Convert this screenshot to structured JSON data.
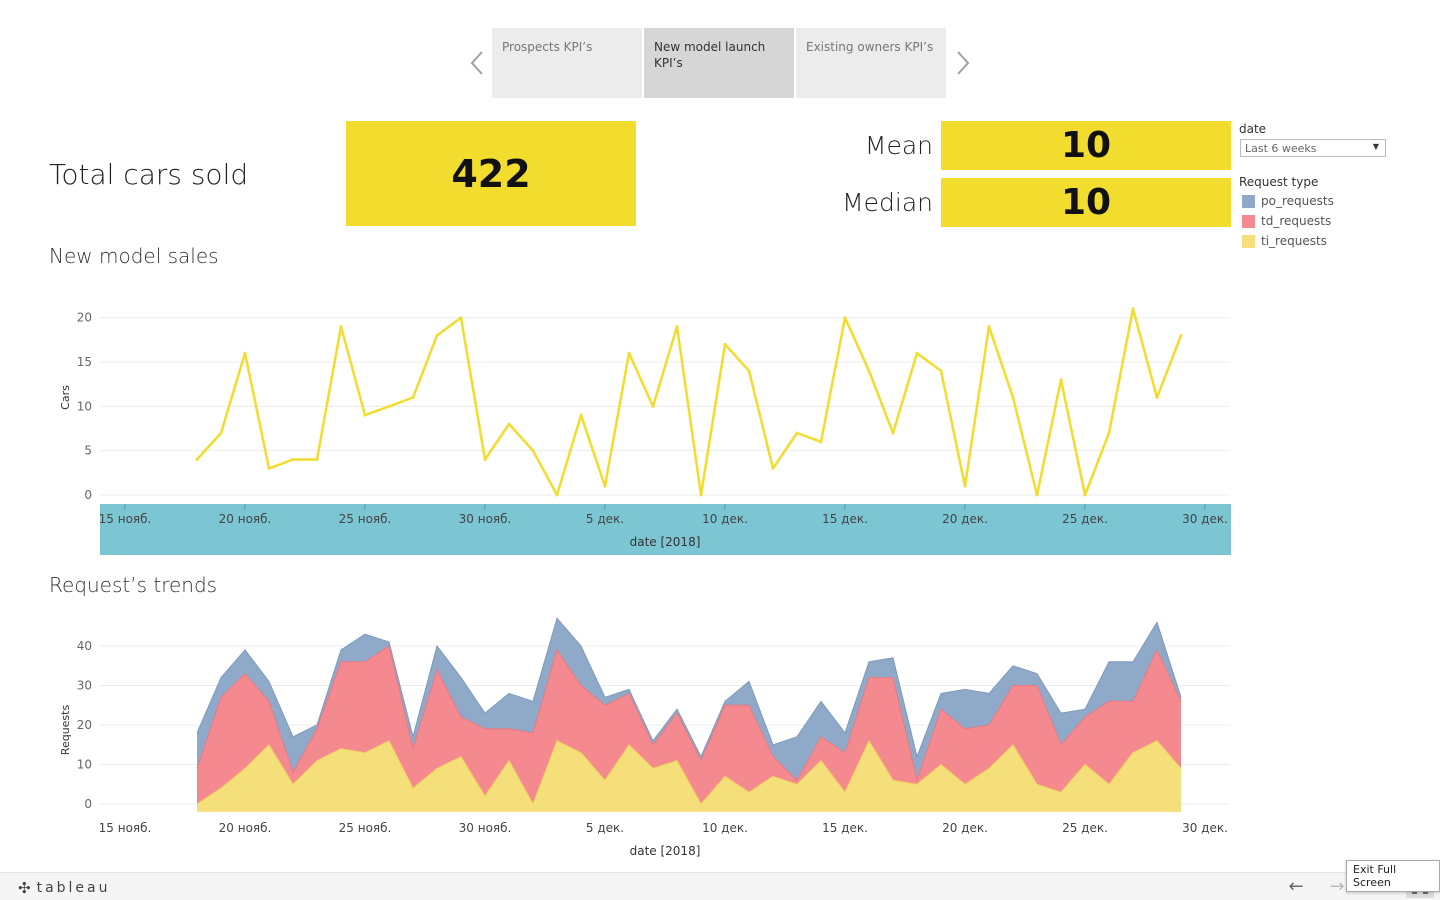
{
  "story_nav": {
    "prev_icon": "chevron-left-icon",
    "next_icon": "chevron-right-icon",
    "tabs": [
      {
        "label": "Prospects KPI’s",
        "active": false
      },
      {
        "label": "New model launch KPI’s",
        "active": true
      },
      {
        "label": "Existing owners KPI’s",
        "active": false
      }
    ]
  },
  "kpis": {
    "total_label": "Total cars sold",
    "total_value": "422",
    "mean_label": "Mean",
    "mean_value": "10",
    "median_label": "Median",
    "median_value": "10",
    "box_color": "#f2dc2d"
  },
  "filter": {
    "title": "date",
    "selected": "Last 6 weeks"
  },
  "legend": {
    "title": "Request type",
    "items": [
      {
        "label": "po_requests",
        "color": "#8fa9c8"
      },
      {
        "label": "td_requests",
        "color": "#f48a90"
      },
      {
        "label": "ti_requests",
        "color": "#f5df7a"
      }
    ]
  },
  "chart_data": [
    {
      "type": "line",
      "title": "New model sales",
      "ylabel": "Cars",
      "xlabel": "date [2018]",
      "x_tick_labels": [
        "15 нояб.",
        "20 нояб.",
        "25 нояб.",
        "30 нояб.",
        "5 дек.",
        "10 дек.",
        "15 дек.",
        "20 дек.",
        "25 дек.",
        "30 дек."
      ],
      "y_ticks": [
        0,
        5,
        10,
        15,
        20
      ],
      "ylim": [
        0,
        22
      ],
      "x_start": "2018-11-18",
      "x_end": "2018-12-29",
      "grid": true,
      "axis_band_color": "#7cc5d3",
      "line_color": "#f2dc2d",
      "series": [
        {
          "values": [
            4,
            7,
            16,
            3,
            4,
            4,
            19,
            9,
            10,
            11,
            18,
            20,
            4,
            8,
            5,
            0,
            9,
            1,
            16,
            10,
            19,
            0,
            17,
            14,
            3,
            7,
            6,
            20,
            14,
            7,
            16,
            14,
            1,
            19,
            11,
            0,
            13,
            0,
            7,
            21,
            11,
            18
          ]
        }
      ]
    },
    {
      "type": "area",
      "title": "Request’s trends",
      "ylabel": "Requests",
      "xlabel": "date [2018]",
      "stacked": true,
      "x_tick_labels": [
        "15 нояб.",
        "20 нояб.",
        "25 нояб.",
        "30 нояб.",
        "5 дек.",
        "10 дек.",
        "15 дек.",
        "20 дек.",
        "25 дек.",
        "30 дек."
      ],
      "y_ticks": [
        0,
        10,
        20,
        30,
        40
      ],
      "ylim": [
        -2,
        48
      ],
      "x_start": "2018-11-18",
      "x_end": "2018-12-29",
      "grid": true,
      "series": [
        {
          "name": "ti_requests",
          "color": "#f5df7a",
          "values": [
            0,
            4,
            9,
            15,
            5,
            11,
            14,
            13,
            16,
            4,
            9,
            12,
            2,
            11,
            0,
            16,
            13,
            6,
            15,
            9,
            11,
            0,
            7,
            3,
            7,
            5,
            11,
            3,
            16,
            6,
            5,
            10,
            5,
            9,
            15,
            5,
            3,
            10,
            5,
            13,
            16,
            9
          ]
        },
        {
          "name": "td_requests",
          "color": "#f48a90",
          "values": [
            9,
            23,
            24,
            11,
            3,
            8,
            22,
            23,
            24,
            10,
            25,
            10,
            17,
            8,
            18,
            23,
            17,
            19,
            13,
            6,
            12,
            11,
            18,
            22,
            5,
            1,
            6,
            10,
            16,
            26,
            1,
            14,
            14,
            11,
            15,
            25,
            12,
            12,
            21,
            13,
            23,
            17
          ]
        },
        {
          "name": "po_requests",
          "color": "#8fa9c8",
          "values": [
            9,
            5,
            6,
            5,
            9,
            1,
            3,
            7,
            1,
            3,
            6,
            10,
            4,
            9,
            8,
            8,
            10,
            2,
            1,
            1,
            1,
            1,
            1,
            6,
            3,
            11,
            9,
            5,
            4,
            5,
            6,
            4,
            10,
            8,
            5,
            3,
            8,
            2,
            10,
            10,
            7,
            1
          ]
        }
      ]
    }
  ],
  "toolbar": {
    "brand": "tableau",
    "brand_icon": "tableau-logo-icon",
    "undo_icon": "arrow-left-icon",
    "redo_icon": "arrow-right-icon",
    "revert_icon": "revert-icon",
    "fullscreen_icon": "fullscreen-icon",
    "tooltip": "Exit Full Screen"
  }
}
